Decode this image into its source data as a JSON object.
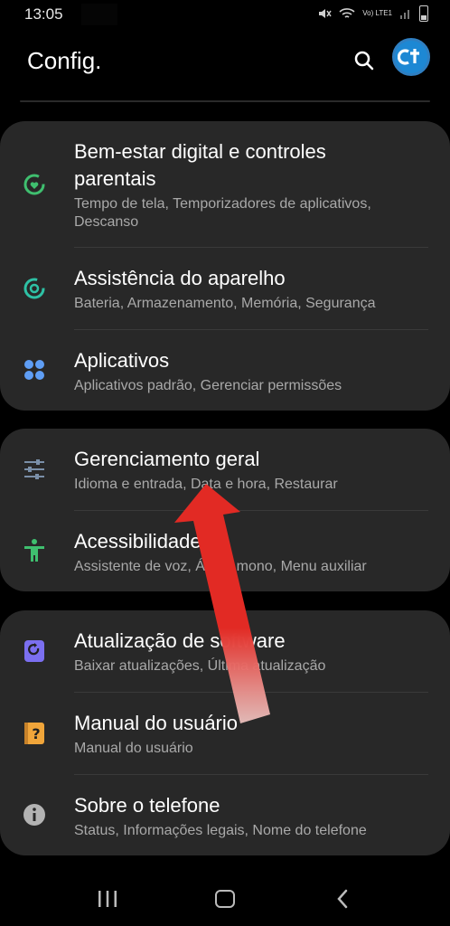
{
  "status_bar": {
    "time": "13:05",
    "network": "Vo) LTE1"
  },
  "header": {
    "title": "Config."
  },
  "cards": [
    {
      "rows": [
        {
          "title_line1": "Bem-estar digital e controles",
          "title_line2": "parentais",
          "subtitle_line1": "Tempo de tela, Temporizadores de aplicativos,",
          "subtitle_line2": "Descanso",
          "icon": "digital-wellbeing-icon",
          "icon_color": "#3fbf6f"
        },
        {
          "title": "Assistência do aparelho",
          "subtitle": "Bateria, Armazenamento, Memória, Segurança",
          "icon": "device-care-icon",
          "icon_color": "#2ec1a5"
        },
        {
          "title": "Aplicativos",
          "subtitle": "Aplicativos padrão, Gerenciar permissões",
          "icon": "apps-icon",
          "icon_color": "#5f9ef5"
        }
      ]
    },
    {
      "rows": [
        {
          "title": "Gerenciamento geral",
          "subtitle": "Idioma e entrada, Data e hora, Restaurar",
          "icon": "sliders-icon",
          "icon_color": "#7a8fa8"
        },
        {
          "title": "Acessibilidade",
          "subtitle": "Assistente de voz, Áudio mono, Menu auxiliar",
          "icon": "accessibility-icon",
          "icon_color": "#3fbf6f"
        }
      ]
    },
    {
      "rows": [
        {
          "title": "Atualização de software",
          "subtitle": "Baixar atualizações, Última atualização",
          "icon": "software-update-icon",
          "icon_color": "#7b6ff0"
        },
        {
          "title": "Manual do usuário",
          "subtitle": "Manual do usuário",
          "icon": "user-manual-icon",
          "icon_color": "#f0a53a"
        },
        {
          "title": "Sobre o telefone",
          "subtitle": "Status, Informações legais, Nome do telefone",
          "icon": "info-icon",
          "icon_color": "#b3b3b3"
        }
      ]
    }
  ],
  "annotation": {
    "color": "#e22a24"
  }
}
